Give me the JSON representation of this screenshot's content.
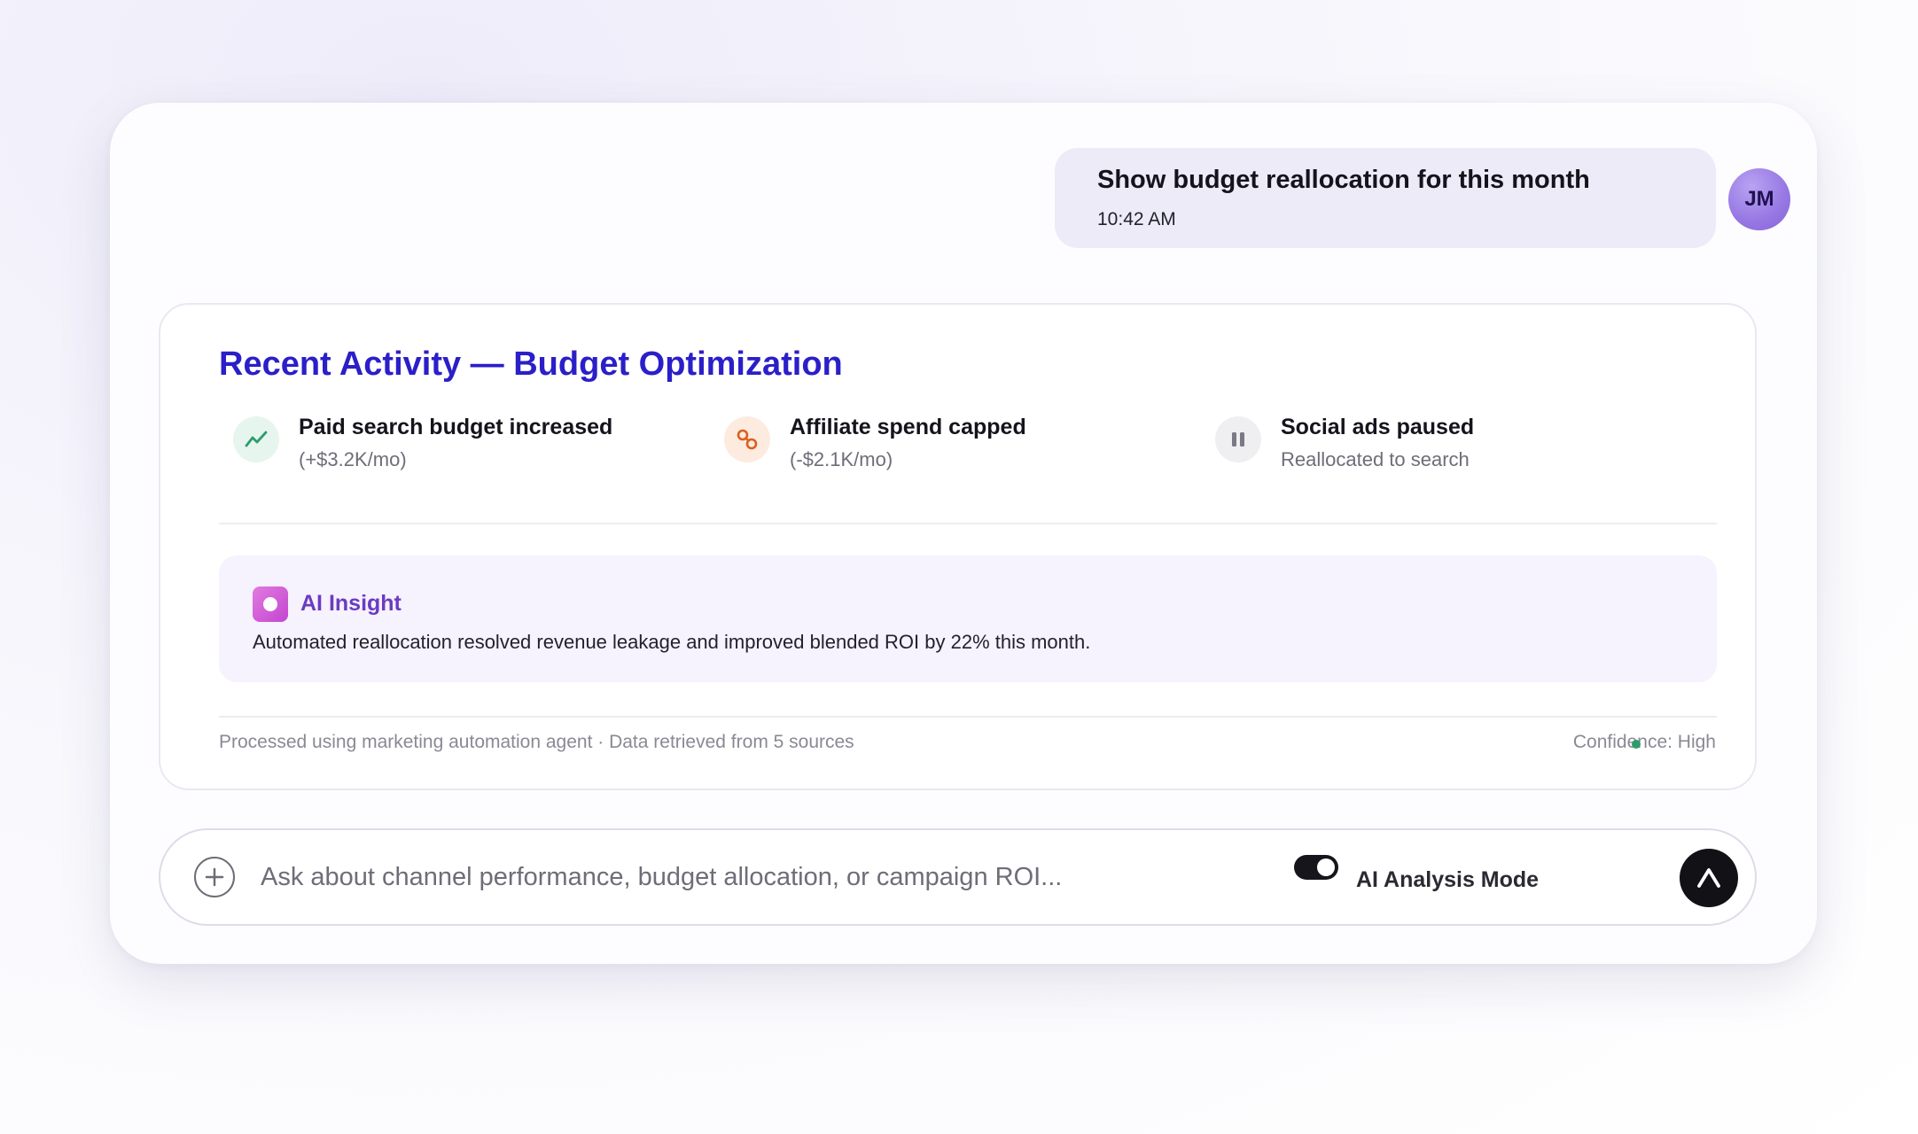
{
  "conversation": {
    "user_message": {
      "text": "Show budget reallocation for this month",
      "timestamp": "10:42 AM",
      "avatar_initials": "JM"
    }
  },
  "activity_card": {
    "title": "Recent Activity — Budget Optimization",
    "items": [
      {
        "title": "Paid search budget increased",
        "detail": "(+$3.2K/mo)",
        "icon": "trend-up-icon",
        "icon_color": "#2e9c6b"
      },
      {
        "title": "Affiliate spend capped",
        "detail": "(-$2.1K/mo)",
        "icon": "link-icon",
        "icon_color": "#d9621c"
      },
      {
        "title": "Social ads paused",
        "detail": "Reallocated to search",
        "icon": "pause-icon",
        "icon_color": "#7a7984"
      }
    ],
    "insight": {
      "label": "AI Insight",
      "text": "Automated reallocation resolved revenue leakage and improved blended ROI by 22% this month.",
      "icon": "sparkle-icon"
    },
    "footer": {
      "processing_note": "Processed using marketing automation agent · Data retrieved from 5 sources",
      "confidence": "Confidence: High"
    }
  },
  "chat_input": {
    "placeholder": "Ask about channel performance, budget allocation, or campaign ROI...",
    "value": "",
    "mode_label": "AI Analysis Mode",
    "mode_enabled": true
  },
  "colors": {
    "accent_title": "#2a1fc8",
    "insight_accent": "#6b3cc0",
    "user_bubble": "#ecebf7",
    "avatar": "#9677e3",
    "send_button": "#111116"
  }
}
